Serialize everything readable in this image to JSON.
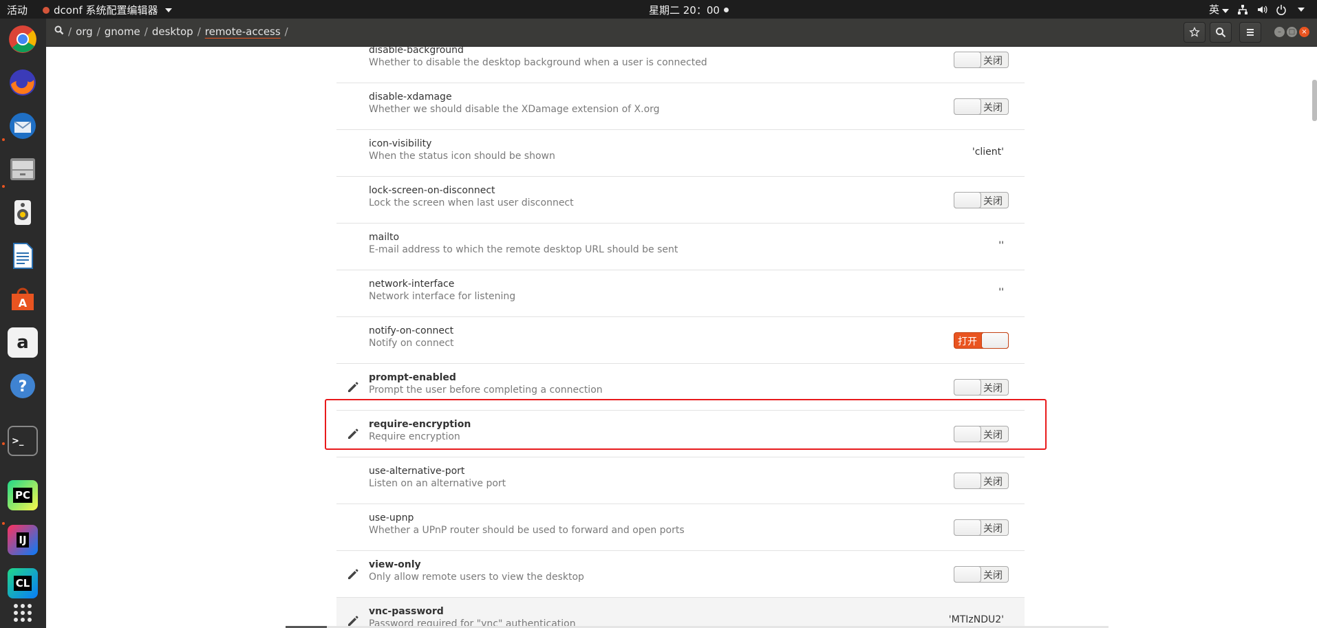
{
  "topbar": {
    "activities": "活动",
    "app_name": "dconf 系统配置编辑器",
    "clock": "星期二 20：00",
    "input_method": "英"
  },
  "dock": [
    {
      "name": "chrome",
      "label": ""
    },
    {
      "name": "firefox",
      "label": ""
    },
    {
      "name": "thunderbird",
      "label": ""
    },
    {
      "name": "files",
      "label": ""
    },
    {
      "name": "rhythmbox",
      "label": ""
    },
    {
      "name": "libreoffice-writer",
      "label": ""
    },
    {
      "name": "software-center",
      "label": "A"
    },
    {
      "name": "amazon",
      "label": "a"
    },
    {
      "name": "help",
      "label": "?"
    },
    {
      "name": "terminal",
      "label": ">_"
    },
    {
      "name": "pycharm",
      "label": "PC"
    },
    {
      "name": "intellij",
      "label": "IJ"
    },
    {
      "name": "clion",
      "label": "CL"
    }
  ],
  "breadcrumb": [
    "org",
    "gnome",
    "desktop",
    "remote-access"
  ],
  "keys": [
    {
      "name": "disable-background",
      "desc": "Whether to disable the desktop background when a user is connected",
      "kind": "switch",
      "state": "off",
      "label": "关闭",
      "modified": false
    },
    {
      "name": "disable-xdamage",
      "desc": "Whether we should disable the XDamage extension of X.org",
      "kind": "switch",
      "state": "off",
      "label": "关闭",
      "modified": false
    },
    {
      "name": "icon-visibility",
      "desc": "When the status icon should be shown",
      "kind": "value",
      "value": "'client'",
      "modified": false
    },
    {
      "name": "lock-screen-on-disconnect",
      "desc": "Lock the screen when last user disconnect",
      "kind": "switch",
      "state": "off",
      "label": "关闭",
      "modified": false
    },
    {
      "name": "mailto",
      "desc": "E-mail address to which the remote desktop URL should be sent",
      "kind": "value",
      "value": "''",
      "modified": false
    },
    {
      "name": "network-interface",
      "desc": "Network interface for listening",
      "kind": "value",
      "value": "''",
      "modified": false
    },
    {
      "name": "notify-on-connect",
      "desc": "Notify on connect",
      "kind": "switch",
      "state": "on",
      "label": "打开",
      "modified": false
    },
    {
      "name": "prompt-enabled",
      "desc": "Prompt the user before completing a connection",
      "kind": "switch",
      "state": "off",
      "label": "关闭",
      "modified": true
    },
    {
      "name": "require-encryption",
      "desc": "Require encryption",
      "kind": "switch",
      "state": "off",
      "label": "关闭",
      "modified": true
    },
    {
      "name": "use-alternative-port",
      "desc": "Listen on an alternative port",
      "kind": "switch",
      "state": "off",
      "label": "关闭",
      "modified": false
    },
    {
      "name": "use-upnp",
      "desc": "Whether a UPnP router should be used to forward and open ports",
      "kind": "switch",
      "state": "off",
      "label": "关闭",
      "modified": false
    },
    {
      "name": "view-only",
      "desc": "Only allow remote users to view the desktop",
      "kind": "switch",
      "state": "off",
      "label": "关闭",
      "modified": true
    },
    {
      "name": "vnc-password",
      "desc": "Password required for \"vnc\" authentication",
      "kind": "value",
      "value": "'MTIzNDU2'",
      "modified": true
    }
  ],
  "colors": {
    "accent": "#e95420",
    "highlight": "#e8191b"
  }
}
